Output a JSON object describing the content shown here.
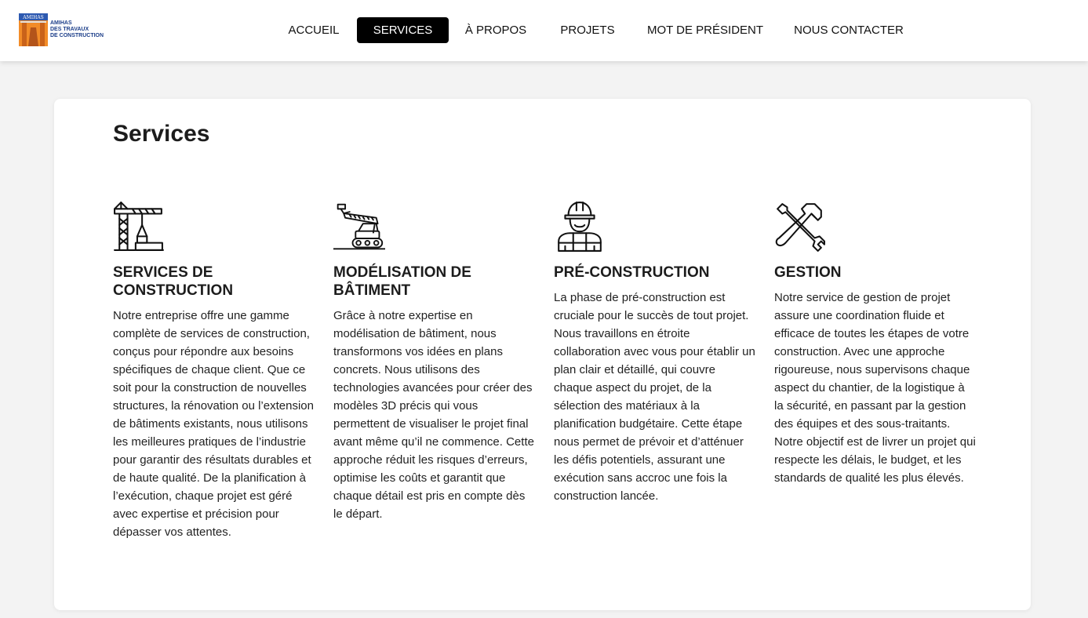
{
  "brand": {
    "mark_text": "AMIHAS",
    "name_lines": [
      "AMIHAS",
      "DES TRAVAUX",
      "DE CONSTRUCTION"
    ],
    "colors": {
      "orange": "#f28c28",
      "blue": "#1d3f8a"
    }
  },
  "nav": {
    "items": [
      {
        "label": "ACCUEIL",
        "active": false
      },
      {
        "label": "SERVICES",
        "active": true
      },
      {
        "label": "À PROPOS",
        "active": false
      },
      {
        "label": "PROJETS",
        "active": false
      },
      {
        "label": "MOT DE PRÉSIDENT",
        "active": false
      },
      {
        "label": "NOUS CONTACTER",
        "active": false
      }
    ]
  },
  "main": {
    "title": "Services",
    "services": [
      {
        "icon": "crane-icon",
        "title": "SERVICES DE CONSTRUCTION",
        "text": "Notre entreprise offre une gamme complète de services de construction, conçus pour répondre aux besoins spécifiques de chaque client. Que ce soit pour la construction de nouvelles structures, la rénovation ou l’extension de bâtiments existants, nous utilisons les meilleures pratiques de l’industrie pour garantir des résultats durables et de haute qualité. De la planification à l’exécution, chaque projet est géré avec expertise et précision pour dépasser vos attentes."
      },
      {
        "icon": "excavator-icon",
        "title": "MODÉLISATION DE BÂTIMENT",
        "text": "Grâce à notre expertise en modélisation de bâtiment, nous transformons vos idées en plans concrets. Nous utilisons des technologies avancées pour créer des modèles 3D précis qui vous permettent de visualiser le projet final avant même qu’il ne commence. Cette approche réduit les risques d’erreurs, optimise les coûts et garantit que chaque détail est pris en compte dès le départ."
      },
      {
        "icon": "worker-icon",
        "title": "PRÉ-CONSTRUCTION",
        "text": "La phase de pré-construction est cruciale pour le succès de tout projet. Nous travaillons en étroite collaboration avec vous pour établir un plan clair et détaillé, qui couvre chaque aspect du projet, de la sélection des matériaux à la planification budgétaire. Cette étape nous permet de prévoir et d’atténuer les défis potentiels, assurant une exécution sans accroc une fois la construction lancée."
      },
      {
        "icon": "tools-icon",
        "title": "GESTION",
        "text": "Notre service de gestion de projet assure une coordination fluide et efficace de toutes les étapes de votre construction. Avec une approche rigoureuse, nous supervisons chaque aspect du chantier, de la logistique à la sécurité, en passant par la gestion des équipes et des sous-traitants. Notre objectif est de livrer un projet qui respecte les délais, le budget, et les standards de qualité les plus élevés."
      }
    ]
  }
}
